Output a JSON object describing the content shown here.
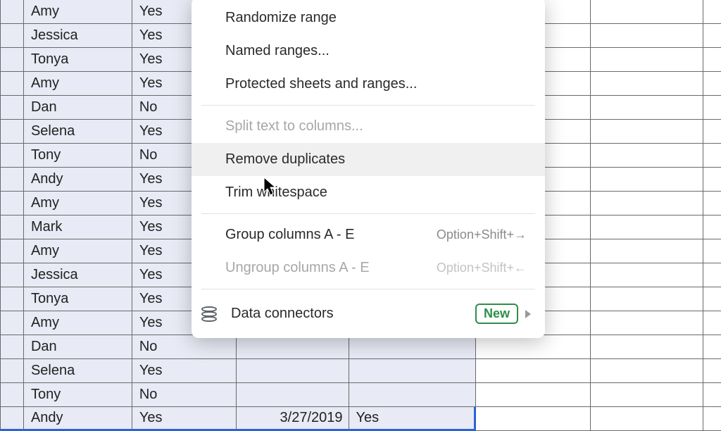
{
  "spreadsheet": {
    "rows": [
      {
        "name": "Amy",
        "col_c": "Yes"
      },
      {
        "name": "Jessica",
        "col_c": "Yes"
      },
      {
        "name": "Tonya",
        "col_c": "Yes"
      },
      {
        "name": "Amy",
        "col_c": "Yes"
      },
      {
        "name": "Dan",
        "col_c": "No"
      },
      {
        "name": "Selena",
        "col_c": "Yes"
      },
      {
        "name": "Tony",
        "col_c": "No"
      },
      {
        "name": "Andy",
        "col_c": "Yes"
      },
      {
        "name": "Amy",
        "col_c": "Yes"
      },
      {
        "name": "Mark",
        "col_c": "Yes"
      },
      {
        "name": "Amy",
        "col_c": "Yes"
      },
      {
        "name": "Jessica",
        "col_c": "Yes"
      },
      {
        "name": "Tonya",
        "col_c": "Yes"
      },
      {
        "name": "Amy",
        "col_c": "Yes"
      },
      {
        "name": "Dan",
        "col_c": "No"
      },
      {
        "name": "Selena",
        "col_c": "Yes"
      },
      {
        "name": "Tony",
        "col_c": "No"
      },
      {
        "name": "Andy",
        "col_c": "Yes",
        "col_d": "3/27/2019",
        "col_e": "Yes"
      }
    ]
  },
  "menu": {
    "randomize": "Randomize range",
    "named_ranges": "Named ranges...",
    "protected": "Protected sheets and ranges...",
    "split": "Split text to columns...",
    "remove_dup": "Remove duplicates",
    "trim": "Trim whitespace",
    "group_cols": "Group columns A - E",
    "group_sc": "Option+Shift+→",
    "ungroup_cols": "Ungroup columns A - E",
    "ungroup_sc": "Option+Shift+←",
    "data_connectors": "Data connectors",
    "new_badge": "New"
  }
}
